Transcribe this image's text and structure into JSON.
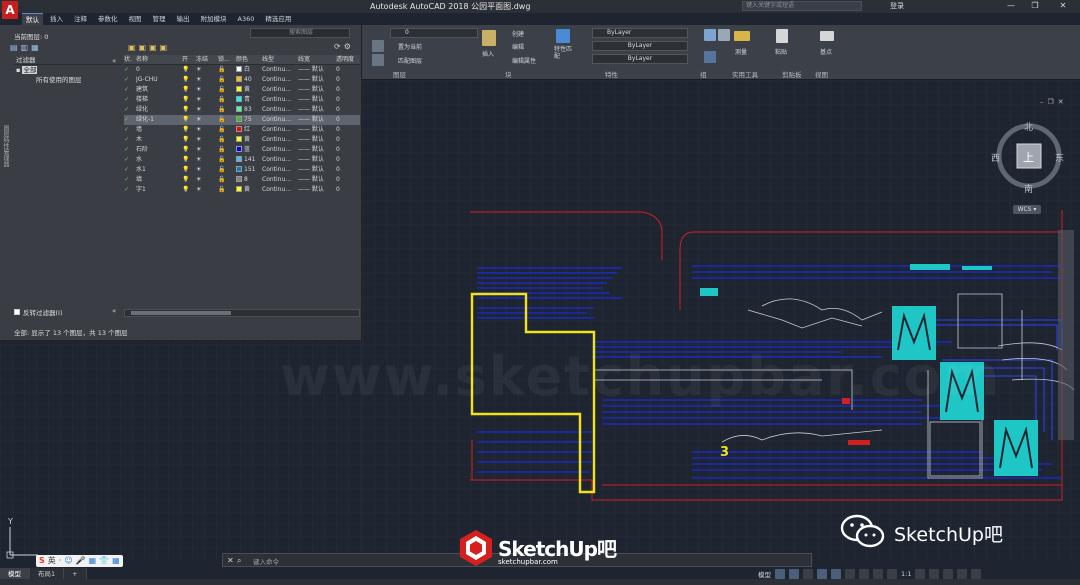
{
  "app": {
    "logo": "A",
    "title": "Autodesk AutoCAD 2018    公园平面图.dwg",
    "search_placeholder": "键入关键字或短语",
    "user": "登录",
    "window_controls": [
      "—",
      "❐",
      "✕"
    ]
  },
  "ribbon_tabs": [
    "默认",
    "插入",
    "注释",
    "参数化",
    "视图",
    "管理",
    "输出",
    "附加模块",
    "A360",
    "精选应用"
  ],
  "ribbon": {
    "layer_dropdown": "0",
    "color_dropdown": "ByLayer",
    "linetype_dropdown": "ByLayer",
    "lineweight_dropdown": "ByLayer",
    "layer_buttons": [
      "置为当前",
      "匹配图层"
    ],
    "insert_label": "插入",
    "block_buttons": [
      "创建",
      "编辑",
      "编辑属性"
    ],
    "match_props_label": "特性匹配",
    "measure_label": "测量",
    "paste_label": "粘贴",
    "base_label": "基点",
    "groups": [
      "图层",
      "块",
      "特性",
      "组",
      "实用工具",
      "剪贴板",
      "视图"
    ]
  },
  "layer_panel": {
    "current_layer": "当前图层: 0",
    "search_placeholder": "搜索图层",
    "filter_header": "过滤器",
    "filters": [
      "全部",
      "所有使用的图层"
    ],
    "invert_filter": "反转过滤器(I)",
    "status": "全部: 显示了 13 个图层，共 13 个图层",
    "columns": [
      "状.",
      "名称",
      "开",
      "冻结",
      "锁...",
      "颜色",
      "线型",
      "线宽",
      "透明度"
    ],
    "rows": [
      {
        "name": "0",
        "color_name": "白",
        "color": "#ffffff",
        "linetype": "Continu...",
        "lineweight": "—— 默认",
        "transparency": "0"
      },
      {
        "name": "JG-CHU",
        "color_name": "40",
        "color": "#ffbf00",
        "linetype": "Continu...",
        "lineweight": "—— 默认",
        "transparency": "0"
      },
      {
        "name": "建筑",
        "color_name": "黄",
        "color": "#ffff00",
        "linetype": "Continu...",
        "lineweight": "—— 默认",
        "transparency": "0"
      },
      {
        "name": "楼梯",
        "color_name": "青",
        "color": "#00ffff",
        "linetype": "Continu...",
        "lineweight": "—— 默认",
        "transparency": "0"
      },
      {
        "name": "绿化",
        "color_name": "83",
        "color": "#3fff9f",
        "linetype": "Continu...",
        "lineweight": "—— 默认",
        "transparency": "0"
      },
      {
        "name": "绿化-1",
        "color_name": "75",
        "color": "#3fbf1f",
        "linetype": "Continu...",
        "lineweight": "—— 默认",
        "transparency": "0"
      },
      {
        "name": "墙",
        "color_name": "红",
        "color": "#ff0000",
        "linetype": "Continu...",
        "lineweight": "—— 默认",
        "transparency": "0"
      },
      {
        "name": "木",
        "color_name": "黄",
        "color": "#ffff00",
        "linetype": "Continu...",
        "lineweight": "—— 默认",
        "transparency": "0"
      },
      {
        "name": "石阶",
        "color_name": "蓝",
        "color": "#0000ff",
        "linetype": "Continu...",
        "lineweight": "—— 默认",
        "transparency": "0"
      },
      {
        "name": "水",
        "color_name": "141",
        "color": "#3fbfff",
        "linetype": "Continu...",
        "lineweight": "—— 默认",
        "transparency": "0"
      },
      {
        "name": "水1",
        "color_name": "151",
        "color": "#0080c0",
        "linetype": "Continu...",
        "lineweight": "—— 默认",
        "transparency": "0"
      },
      {
        "name": "填",
        "color_name": "8",
        "color": "#808080",
        "linetype": "Continu...",
        "lineweight": "—— 默认",
        "transparency": "0"
      },
      {
        "name": "字1",
        "color_name": "黄",
        "color": "#ffff00",
        "linetype": "Continu...",
        "lineweight": "—— 默认",
        "transparency": "0"
      }
    ]
  },
  "viewcube": {
    "north": "北",
    "south": "南",
    "east": "东",
    "west": "西",
    "top": "上",
    "wcs": "WCS ▾"
  },
  "drawing_label": "3",
  "command_line": {
    "placeholder": "键入命令"
  },
  "layout_tabs": [
    "模型",
    "布局1",
    "+"
  ],
  "ime": [
    "S",
    "英",
    "·",
    "☺",
    "🎤",
    "▦",
    "👕",
    "▦"
  ],
  "status_bar": {
    "model": "模型",
    "scale": "1:1"
  },
  "watermarks": {
    "brand": "SketchUp吧",
    "brand_url": "sketchupbar.com",
    "wechat": "SketchUp吧",
    "center": "www.sketchupbar.com"
  },
  "colors": {
    "cad_background": "#1e2530",
    "panel": "#3a3e44",
    "ribbon": "#3b4049",
    "yellow_outline": "#f2e21a",
    "cyan": "#24c8c8",
    "blue": "#1a2bd8",
    "red": "#d82020"
  }
}
